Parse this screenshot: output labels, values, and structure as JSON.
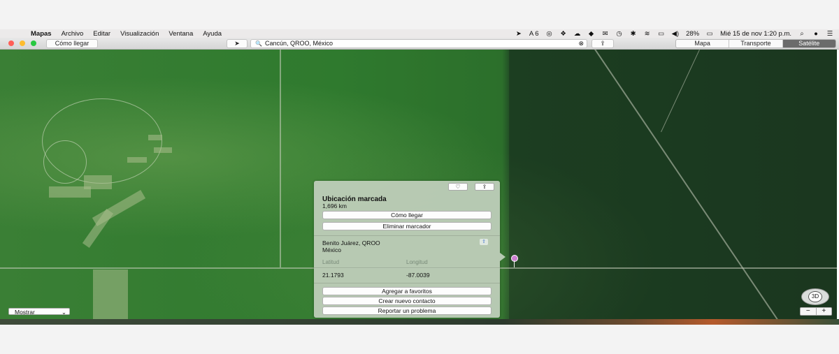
{
  "menubar": {
    "apple": "",
    "items": [
      "Mapas",
      "Archivo",
      "Editar",
      "Visualización",
      "Ventana",
      "Ayuda"
    ],
    "status": {
      "location": "➤",
      "adobe_count": "6",
      "battery": "28%",
      "datetime": "Mié 15 de nov  1:20 p.m."
    }
  },
  "toolbar": {
    "directions": "Cómo llegar",
    "search_value": "Cancún, QROO, México",
    "search_icon": "🔍",
    "share": "⇪",
    "views": [
      "Mapa",
      "Transporte",
      "Satélite"
    ],
    "selected_view": "Satélite"
  },
  "popover": {
    "title": "Ubicación marcada",
    "distance": "1,696 km",
    "directions_button": "Cómo llegar",
    "remove_pin_button": "Eliminar marcador",
    "address_line1": "Benito Juárez, QROO",
    "address_line2": "México",
    "latitude_label": "Latitud",
    "longitude_label": "Longitud",
    "latitude": "21.1793",
    "longitude": "-87.0039",
    "add_favorite_button": "Agregar a favoritos",
    "new_contact_button": "Crear nuevo contacto",
    "report_button": "Reportar un problema"
  },
  "map_controls": {
    "show_select": "Mostrar",
    "compass": "3D",
    "zoom_out": "−",
    "zoom_in": "+"
  },
  "colors": {
    "selected_segment": "#6b6b6b",
    "pin": "#cc7fd0",
    "satellite_green": "#2f7a2e"
  }
}
